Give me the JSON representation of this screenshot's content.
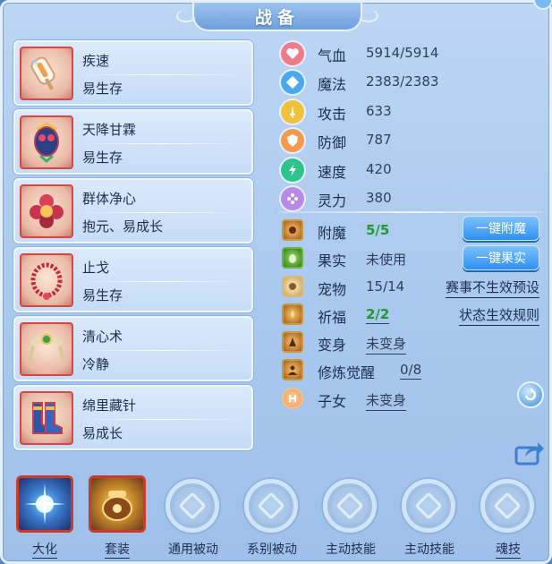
{
  "window": {
    "title": "战备"
  },
  "left_list": [
    {
      "name": "疾速",
      "desc": "易生存",
      "icon": "popsicle-icon"
    },
    {
      "name": "天降甘霖",
      "desc": "易生存",
      "icon": "mask-icon"
    },
    {
      "name": "群体净心",
      "desc": "抱元、易成长",
      "icon": "flower-icon"
    },
    {
      "name": "止戈",
      "desc": "易生存",
      "icon": "bead-necklace-icon"
    },
    {
      "name": "清心术",
      "desc": "冷静",
      "icon": "jade-rope-icon"
    },
    {
      "name": "绵里藏针",
      "desc": "易成长",
      "icon": "boots-icon"
    }
  ],
  "stats": [
    {
      "label": "气血",
      "value": "5914/5914",
      "icon": "heart-icon",
      "color": "#f07a8a"
    },
    {
      "label": "魔法",
      "value": "2383/2383",
      "icon": "mana-icon",
      "color": "#4aa9ee"
    },
    {
      "label": "攻击",
      "value": "633",
      "icon": "sword-icon",
      "color": "#f2c13a"
    },
    {
      "label": "防御",
      "value": "787",
      "icon": "shield-icon",
      "color": "#f49a4a"
    },
    {
      "label": "速度",
      "value": "420",
      "icon": "lightning-icon",
      "color": "#2fc58a"
    },
    {
      "label": "灵力",
      "value": "380",
      "icon": "spirit-icon",
      "color": "#b88ae8"
    }
  ],
  "extras": [
    {
      "label": "附魔",
      "value": "5/5",
      "green": true,
      "button": "一键附魔",
      "icon": "enchant-icon"
    },
    {
      "label": "果实",
      "value": "未使用",
      "button": "一键果实",
      "icon": "fruit-icon"
    },
    {
      "label": "宠物",
      "value": "15/14",
      "link": "赛事不生效预设",
      "icon": "pet-icon"
    },
    {
      "label": "祈福",
      "value": "2/2",
      "green": true,
      "link": "状态生效规则",
      "icon": "blessing-icon"
    },
    {
      "label": "变身",
      "value": "未变身",
      "underline": true,
      "icon": "transform-icon"
    },
    {
      "label": "修炼觉醒",
      "value": "0/8",
      "underline": true,
      "icon": "awaken-icon"
    },
    {
      "label": "子女",
      "value": "未变身",
      "underline": true,
      "icon": "child-icon"
    }
  ],
  "tabs": [
    {
      "label": "大化",
      "active": true,
      "underline": true,
      "style": "blue",
      "icon": "starburst-icon"
    },
    {
      "label": "套装",
      "active": true,
      "underline": true,
      "style": "gold",
      "icon": "treasure-pot-icon"
    },
    {
      "label": "通用被动",
      "active": false,
      "icon": "empty-slot-icon"
    },
    {
      "label": "系别被动",
      "active": false,
      "icon": "empty-slot-icon"
    },
    {
      "label": "主动技能",
      "active": false,
      "icon": "empty-slot-icon"
    },
    {
      "label": "主动技能",
      "active": false,
      "icon": "empty-slot-icon"
    },
    {
      "label": "魂技",
      "active": false,
      "underline": true,
      "icon": "empty-slot-icon"
    }
  ]
}
